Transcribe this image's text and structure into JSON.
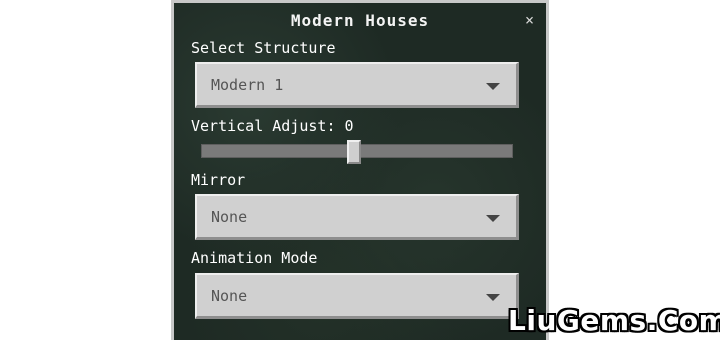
{
  "dialog": {
    "title": "Modern Houses",
    "close_glyph": "×"
  },
  "fields": {
    "structure": {
      "label": "Select Structure",
      "value": "Modern 1"
    },
    "vertical_adjust": {
      "label": "Vertical Adjust: 0",
      "value": 0,
      "range": [
        -10,
        10
      ]
    },
    "mirror": {
      "label": "Mirror",
      "value": "None"
    },
    "animation_mode": {
      "label": "Animation Mode",
      "value": "None"
    }
  },
  "watermark": "LiuGems.Com",
  "icons": {
    "close": "close-icon",
    "dropdown": "chevron-down-icon"
  },
  "colors": {
    "panel_bg": "#1e2a24",
    "control_bg": "#d0d0d0",
    "text": "#ffffff"
  }
}
